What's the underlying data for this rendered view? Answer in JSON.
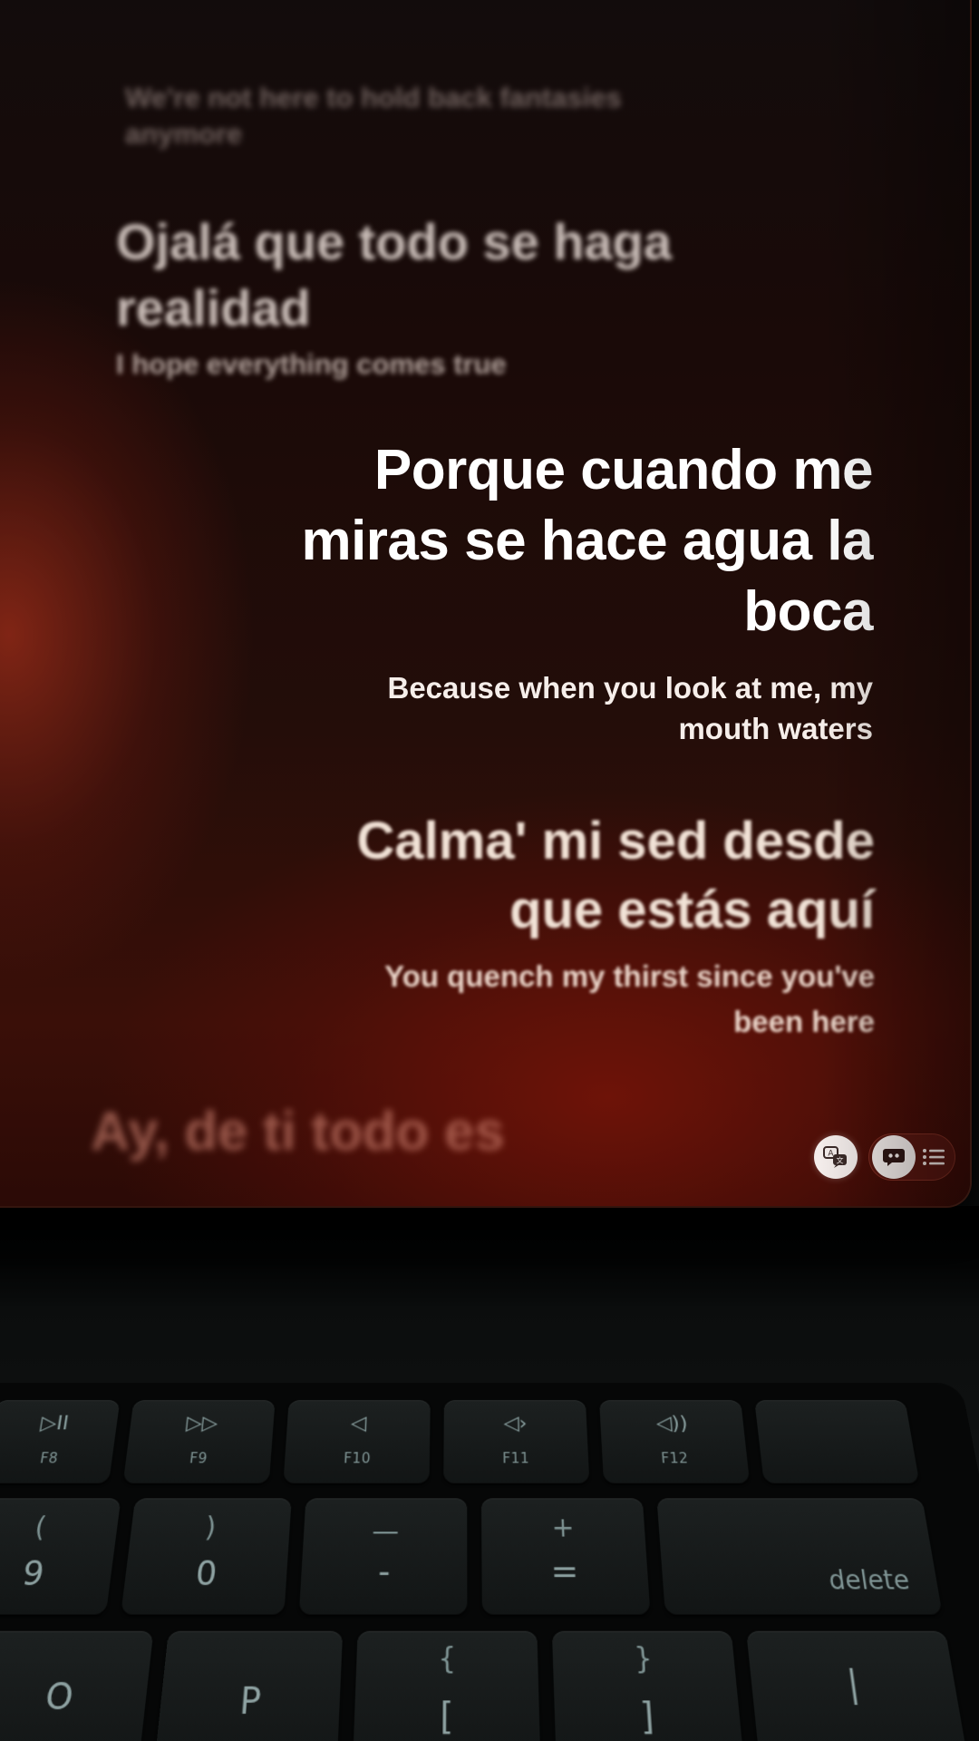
{
  "lyrics": {
    "past_1": {
      "translation": "We're not here to hold back fantasies anymore"
    },
    "past_2": {
      "line": "Ojalá que todo se haga realidad",
      "translation": "I hope everything comes true"
    },
    "current": {
      "line_parts": [
        "Porque cuando me",
        "miras se hace agua la",
        "boca"
      ],
      "translation_parts": [
        "Because when you look at me, my",
        "mouth waters"
      ]
    },
    "next": {
      "line_parts": [
        "Calma' mi sed desde",
        "que estás aquí"
      ],
      "translation_parts": [
        "You quench my thirst since you've",
        "been here"
      ]
    },
    "later": {
      "line": "Ay, de ti todo es"
    }
  },
  "controls": {
    "translate_icon": "translate-icon",
    "lyrics_icon": "lyrics-quote-icon",
    "queue_icon": "list-icon"
  },
  "keyboard": {
    "function_row": [
      {
        "glyph": "▷II",
        "label": "F8",
        "icon": "play-pause-icon"
      },
      {
        "glyph": "▷▷",
        "label": "F9",
        "icon": "fast-forward-icon"
      },
      {
        "glyph": "◁",
        "label": "F10",
        "icon": "mute-icon"
      },
      {
        "glyph": "◁›",
        "label": "F11",
        "icon": "volume-down-icon"
      },
      {
        "glyph": "◁))",
        "label": "F12",
        "icon": "volume-up-icon"
      }
    ],
    "number_row": [
      {
        "top": "(",
        "bottom": "9"
      },
      {
        "top": ")",
        "bottom": "0"
      },
      {
        "top": "—",
        "bottom": "-"
      },
      {
        "top": "+",
        "bottom": "="
      },
      {
        "label": "delete"
      }
    ],
    "letter_row": [
      {
        "bottom": "O"
      },
      {
        "bottom": "P"
      },
      {
        "top": "{",
        "bottom": "["
      },
      {
        "top": "}",
        "bottom": "]"
      },
      {
        "bottom": "|"
      }
    ]
  },
  "colors": {
    "current_line": "#ffffff",
    "screen_glow": "#7a1a0c"
  }
}
